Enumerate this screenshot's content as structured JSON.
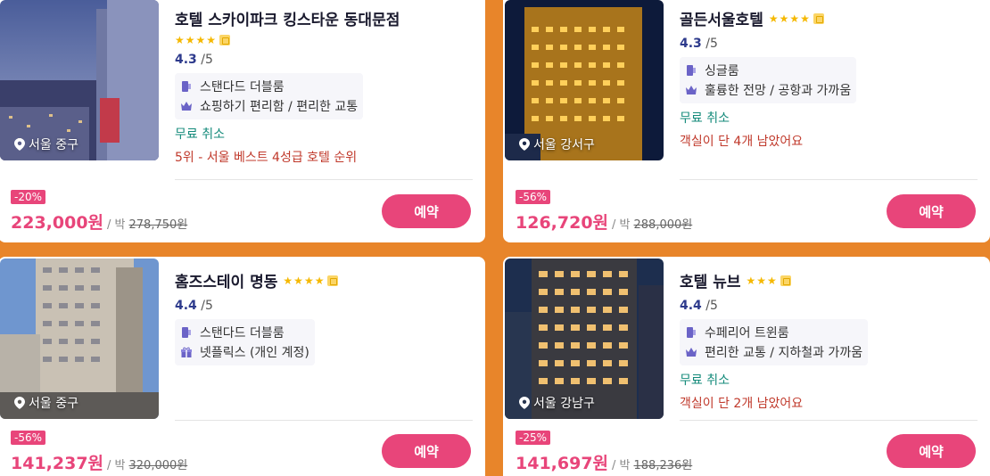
{
  "hotels": [
    {
      "name": "호텔 스카이파크 킹스타운 동대문점",
      "stars": 4,
      "rating": "4.3",
      "rating_max": "/5",
      "location": "서울 중구",
      "features": [
        {
          "icon": "room-icon",
          "text": "스탠다드 더블룸"
        },
        {
          "icon": "crown-icon",
          "text": "쇼핑하기 편리함 / 편리한 교통"
        }
      ],
      "cancel": "무료 취소",
      "note": "5위 - 서울 베스트 4성급 호텔 순위",
      "discount": "-20%",
      "price": "223,000원",
      "per": "/ 박",
      "original_price": "278,750원",
      "book_label": "예약"
    },
    {
      "name": "골든서울호텔",
      "stars": 4,
      "rating": "4.3",
      "rating_max": "/5",
      "location": "서울 강서구",
      "features": [
        {
          "icon": "room-icon",
          "text": "싱글룸"
        },
        {
          "icon": "crown-icon",
          "text": "훌륭한 전망 / 공항과 가까움"
        }
      ],
      "cancel": "무료 취소",
      "note": "객실이 단 4개 남았어요",
      "discount": "-56%",
      "price": "126,720원",
      "per": "/ 박",
      "original_price": "288,000원",
      "book_label": "예약"
    },
    {
      "name": "홈즈스테이 명동",
      "stars": 4,
      "rating": "4.4",
      "rating_max": "/5",
      "location": "서울 중구",
      "features": [
        {
          "icon": "room-icon",
          "text": "스탠다드 더블룸"
        },
        {
          "icon": "gift-icon",
          "text": "넷플릭스 (개인 계정)"
        }
      ],
      "cancel": "",
      "note": "",
      "discount": "-56%",
      "price": "141,237원",
      "per": "/ 박",
      "original_price": "320,000원",
      "book_label": "예약"
    },
    {
      "name": "호텔 뉴브",
      "stars": 3,
      "rating": "4.4",
      "rating_max": "/5",
      "location": "서울 강남구",
      "features": [
        {
          "icon": "room-icon",
          "text": "수페리어 트윈룸"
        },
        {
          "icon": "crown-icon",
          "text": "편리한 교통 / 지하철과 가까움"
        }
      ],
      "cancel": "무료 취소",
      "note": "객실이 단 2개 남았어요",
      "discount": "-25%",
      "price": "141,697원",
      "per": "/ 박",
      "original_price": "188,236원",
      "book_label": "예약"
    }
  ],
  "colors": {
    "background": "#e8852a",
    "accent": "#e8457a",
    "rating": "#2d3a8c",
    "cancel": "#138a7a",
    "note": "#c0392b",
    "star": "#f5b800"
  }
}
